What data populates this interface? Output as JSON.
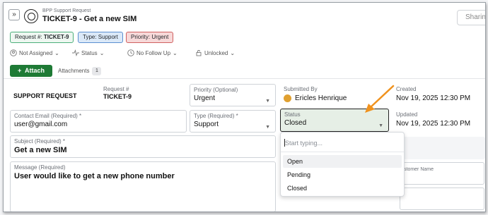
{
  "header": {
    "breadcrumb": "BPP Support Request",
    "title": "TICKET-9 - Get a new SIM",
    "expand_icon": "»",
    "share_label": "Sharin"
  },
  "tags": {
    "request_prefix": "Request #: ",
    "request_value": "TICKET-9",
    "type_prefix": "Type: ",
    "type_value": "Support",
    "priority_prefix": "Priority: ",
    "priority_value": "Urgent"
  },
  "filters": {
    "assignee": "Not Assigned",
    "status": "Status",
    "follow_up": "No Follow Up",
    "lock": "Unlocked"
  },
  "toolbar": {
    "attach_label": "Attach",
    "attach_icon": "+",
    "attachments_label": "Attachments",
    "attachments_count": "1"
  },
  "form": {
    "section_title": "SUPPORT REQUEST",
    "request_label": "Request #",
    "request_value": "TICKET-9",
    "priority_label": "Priority (Optional)",
    "priority_value": "Urgent",
    "submitted_by_label": "Submitted By",
    "submitted_by_value": "Ericles Henrique",
    "created_label": "Created",
    "created_value": "Nov 19, 2025 12:30 PM",
    "contact_label": "Contact Email (Required) *",
    "contact_value": "user@gmail.com",
    "type_label": "Type (Required) *",
    "type_value": "Support",
    "status_label": "Status",
    "status_value": "Closed",
    "updated_label": "Updated",
    "updated_value": "Nov 19, 2025 12:30 PM",
    "subject_label": "Subject (Required) *",
    "subject_value": "Get a new SIM",
    "message_label": "Message (Required)",
    "message_value": "User would like to get a new phone number",
    "customer_name_label": "stomer Name"
  },
  "status_dropdown": {
    "placeholder": "Start typing...",
    "options": [
      "Open",
      "Pending",
      "Closed"
    ]
  },
  "colors": {
    "accent_green": "#1e7a35",
    "arrow_orange": "#f0921e"
  }
}
